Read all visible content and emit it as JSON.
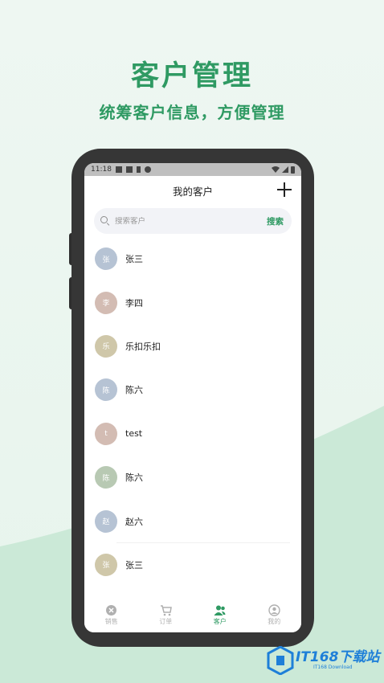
{
  "hero": {
    "title": "客户管理",
    "subtitle": "统筹客户信息，方便管理"
  },
  "status_bar": {
    "time": "11:18"
  },
  "header": {
    "title": "我的客户"
  },
  "search": {
    "placeholder": "搜索客户",
    "button": "搜索"
  },
  "customers": [
    {
      "initial": "张",
      "name": "张三",
      "color": "#b6c3d4"
    },
    {
      "initial": "李",
      "name": "李四",
      "color": "#d3bcb3"
    },
    {
      "initial": "乐",
      "name": "乐扣乐扣",
      "color": "#cfc7a9"
    },
    {
      "initial": "陈",
      "name": "陈六",
      "color": "#b6c3d4"
    },
    {
      "initial": "t",
      "name": "test",
      "color": "#d3bcb3"
    },
    {
      "initial": "陈",
      "name": "陈六",
      "color": "#b8c9b3"
    },
    {
      "initial": "赵",
      "name": "赵六",
      "color": "#b6c3d4"
    },
    {
      "initial": "张",
      "name": "张三",
      "color": "#cfc7a9"
    }
  ],
  "tabs": [
    {
      "label": "销售",
      "icon": "sales-icon",
      "active": false
    },
    {
      "label": "订单",
      "icon": "cart-icon",
      "active": false
    },
    {
      "label": "客户",
      "icon": "customers-icon",
      "active": true
    },
    {
      "label": "我的",
      "icon": "profile-icon",
      "active": false
    }
  ],
  "watermark": {
    "main": "IT168下载站",
    "sub": "IT168 Download"
  },
  "colors": {
    "accent": "#2f9a63"
  }
}
